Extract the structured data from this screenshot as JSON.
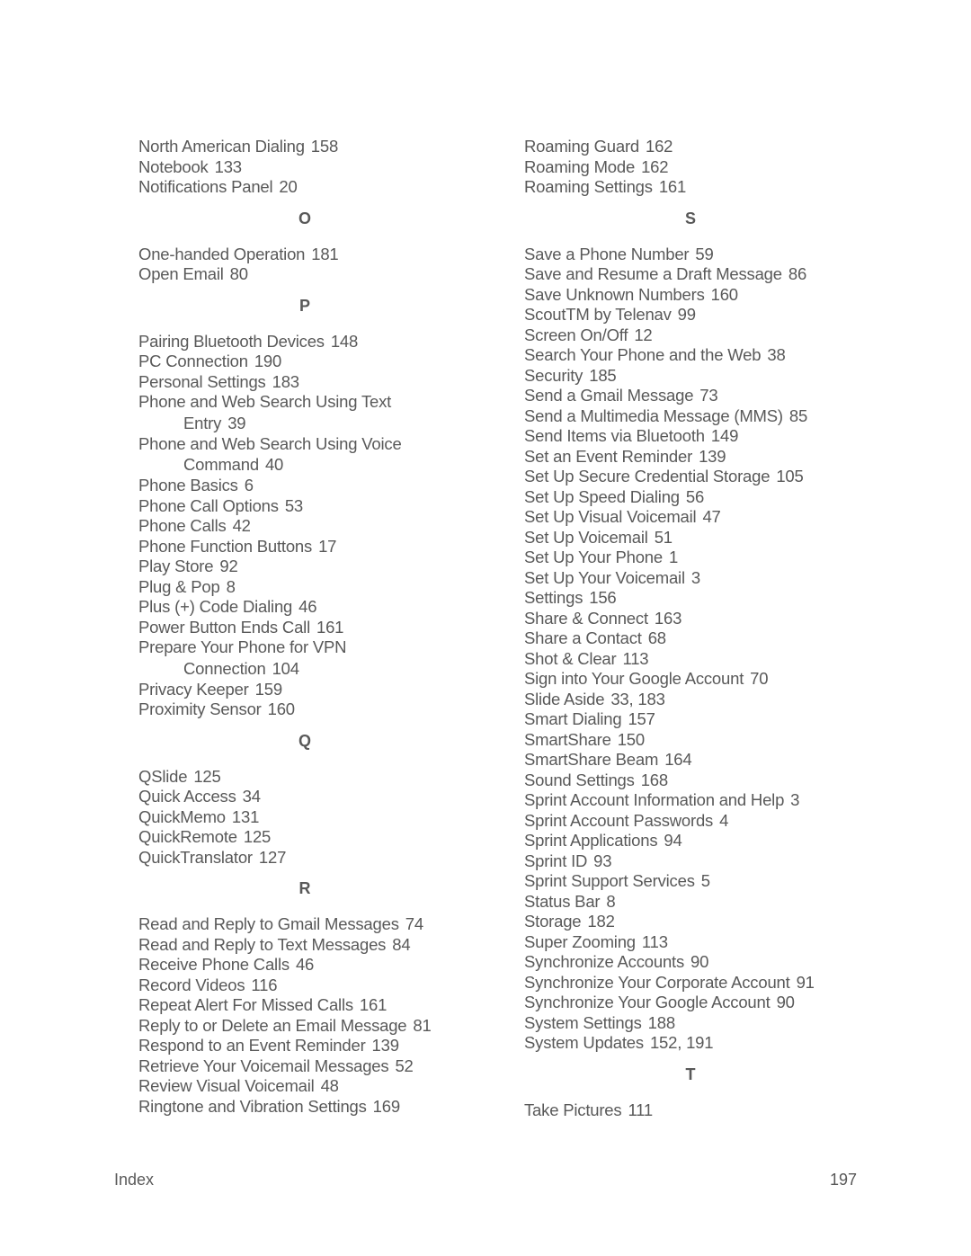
{
  "left_column": [
    {
      "type": "entry",
      "text": "North American Dialing",
      "pages": "158"
    },
    {
      "type": "entry",
      "text": "Notebook",
      "pages": "133"
    },
    {
      "type": "entry",
      "text": "Notifications Panel",
      "pages": "20"
    },
    {
      "type": "letter",
      "text": "O"
    },
    {
      "type": "entry",
      "text": "One-handed Operation",
      "pages": "181"
    },
    {
      "type": "entry",
      "text": "Open Email",
      "pages": "80"
    },
    {
      "type": "letter",
      "text": "P"
    },
    {
      "type": "entry",
      "text": "Pairing Bluetooth Devices",
      "pages": "148"
    },
    {
      "type": "entry",
      "text": "PC Connection",
      "pages": "190"
    },
    {
      "type": "entry",
      "text": "Personal Settings",
      "pages": "183"
    },
    {
      "type": "entry",
      "text": "Phone and Web Search Using Text",
      "cont": "Entry",
      "pages": "39"
    },
    {
      "type": "entry",
      "text": "Phone and Web Search Using Voice",
      "cont": "Command",
      "pages": "40"
    },
    {
      "type": "entry",
      "text": "Phone Basics",
      "pages": "6"
    },
    {
      "type": "entry",
      "text": "Phone Call Options",
      "pages": "53"
    },
    {
      "type": "entry",
      "text": "Phone Calls",
      "pages": "42"
    },
    {
      "type": "entry",
      "text": "Phone Function Buttons",
      "pages": "17"
    },
    {
      "type": "entry",
      "text": "Play Store",
      "pages": "92"
    },
    {
      "type": "entry",
      "text": "Plug & Pop",
      "pages": "8"
    },
    {
      "type": "entry",
      "text": "Plus (+) Code Dialing",
      "pages": "46"
    },
    {
      "type": "entry",
      "text": "Power Button Ends Call",
      "pages": "161"
    },
    {
      "type": "entry",
      "text": "Prepare Your Phone for VPN",
      "cont": "Connection",
      "pages": "104"
    },
    {
      "type": "entry",
      "text": "Privacy Keeper",
      "pages": "159"
    },
    {
      "type": "entry",
      "text": "Proximity Sensor",
      "pages": "160"
    },
    {
      "type": "letter",
      "text": "Q"
    },
    {
      "type": "entry",
      "text": "QSlide",
      "pages": "125"
    },
    {
      "type": "entry",
      "text": "Quick Access",
      "pages": "34"
    },
    {
      "type": "entry",
      "text": "QuickMemo",
      "pages": "131"
    },
    {
      "type": "entry",
      "text": "QuickRemote",
      "pages": "125"
    },
    {
      "type": "entry",
      "text": "QuickTranslator",
      "pages": "127"
    },
    {
      "type": "letter",
      "text": "R"
    },
    {
      "type": "entry",
      "text": "Read and Reply to Gmail Messages",
      "pages": "74"
    },
    {
      "type": "entry",
      "text": "Read and Reply to Text Messages",
      "pages": "84"
    },
    {
      "type": "entry",
      "text": "Receive Phone Calls",
      "pages": "46"
    },
    {
      "type": "entry",
      "text": "Record Videos",
      "pages": "116"
    },
    {
      "type": "entry",
      "text": "Repeat Alert For Missed Calls",
      "pages": "161"
    },
    {
      "type": "entry",
      "text": "Reply to or Delete an Email Message",
      "pages": "81"
    },
    {
      "type": "entry",
      "text": "Respond to an Event Reminder",
      "pages": "139"
    },
    {
      "type": "entry",
      "text": "Retrieve Your Voicemail Messages",
      "pages": "52"
    },
    {
      "type": "entry",
      "text": "Review Visual Voicemail",
      "pages": "48"
    },
    {
      "type": "entry",
      "text": "Ringtone and Vibration Settings",
      "pages": "169"
    }
  ],
  "right_column": [
    {
      "type": "entry",
      "text": "Roaming Guard",
      "pages": "162"
    },
    {
      "type": "entry",
      "text": "Roaming Mode",
      "pages": "162"
    },
    {
      "type": "entry",
      "text": "Roaming Settings",
      "pages": "161"
    },
    {
      "type": "letter",
      "text": "S"
    },
    {
      "type": "entry",
      "text": "Save a Phone Number",
      "pages": "59"
    },
    {
      "type": "entry",
      "text": "Save and Resume a Draft Message",
      "pages": "86"
    },
    {
      "type": "entry",
      "text": "Save Unknown Numbers",
      "pages": "160"
    },
    {
      "type": "entry",
      "text": "ScoutTM by Telenav",
      "pages": "99"
    },
    {
      "type": "entry",
      "text": "Screen On/Off",
      "pages": "12"
    },
    {
      "type": "entry",
      "text": "Search Your Phone and the Web",
      "pages": "38"
    },
    {
      "type": "entry",
      "text": "Security",
      "pages": "185"
    },
    {
      "type": "entry",
      "text": "Send a Gmail Message",
      "pages": "73"
    },
    {
      "type": "entry",
      "text": "Send a Multimedia Message (MMS)",
      "pages": "85"
    },
    {
      "type": "entry",
      "text": "Send Items via Bluetooth",
      "pages": "149"
    },
    {
      "type": "entry",
      "text": "Set an Event Reminder",
      "pages": "139"
    },
    {
      "type": "entry",
      "text": "Set Up Secure Credential Storage",
      "pages": "105"
    },
    {
      "type": "entry",
      "text": "Set Up Speed Dialing",
      "pages": "56"
    },
    {
      "type": "entry",
      "text": "Set Up Visual Voicemail",
      "pages": "47"
    },
    {
      "type": "entry",
      "text": "Set Up Voicemail",
      "pages": "51"
    },
    {
      "type": "entry",
      "text": "Set Up Your Phone",
      "pages": "1"
    },
    {
      "type": "entry",
      "text": "Set Up Your Voicemail",
      "pages": "3"
    },
    {
      "type": "entry",
      "text": "Settings",
      "pages": "156"
    },
    {
      "type": "entry",
      "text": "Share & Connect",
      "pages": "163"
    },
    {
      "type": "entry",
      "text": "Share a Contact",
      "pages": "68"
    },
    {
      "type": "entry",
      "text": "Shot & Clear",
      "pages": "113"
    },
    {
      "type": "entry",
      "text": "Sign into Your Google Account",
      "pages": "70"
    },
    {
      "type": "entry",
      "text": "Slide Aside",
      "pages": "33, 183"
    },
    {
      "type": "entry",
      "text": "Smart Dialing",
      "pages": "157"
    },
    {
      "type": "entry",
      "text": "SmartShare",
      "pages": "150"
    },
    {
      "type": "entry",
      "text": "SmartShare Beam",
      "pages": "164"
    },
    {
      "type": "entry",
      "text": "Sound Settings",
      "pages": "168"
    },
    {
      "type": "entry",
      "text": "Sprint Account Information and Help",
      "pages": "3"
    },
    {
      "type": "entry",
      "text": "Sprint Account Passwords",
      "pages": "4"
    },
    {
      "type": "entry",
      "text": "Sprint Applications",
      "pages": "94"
    },
    {
      "type": "entry",
      "text": "Sprint ID",
      "pages": "93"
    },
    {
      "type": "entry",
      "text": "Sprint Support Services",
      "pages": "5"
    },
    {
      "type": "entry",
      "text": "Status Bar",
      "pages": "8"
    },
    {
      "type": "entry",
      "text": "Storage",
      "pages": "182"
    },
    {
      "type": "entry",
      "text": "Super Zooming",
      "pages": "113"
    },
    {
      "type": "entry",
      "text": "Synchronize Accounts",
      "pages": "90"
    },
    {
      "type": "entry",
      "text": "Synchronize Your Corporate Account",
      "pages": "91"
    },
    {
      "type": "entry",
      "text": "Synchronize Your Google Account",
      "pages": "90"
    },
    {
      "type": "entry",
      "text": "System Settings",
      "pages": "188"
    },
    {
      "type": "entry",
      "text": "System Updates",
      "pages": "152, 191"
    },
    {
      "type": "letter",
      "text": "T"
    },
    {
      "type": "entry",
      "text": "Take Pictures",
      "pages": "111"
    }
  ],
  "footer": {
    "section": "Index",
    "page_number": "197"
  },
  "colors": {
    "text": "#595959",
    "background": "#ffffff"
  }
}
